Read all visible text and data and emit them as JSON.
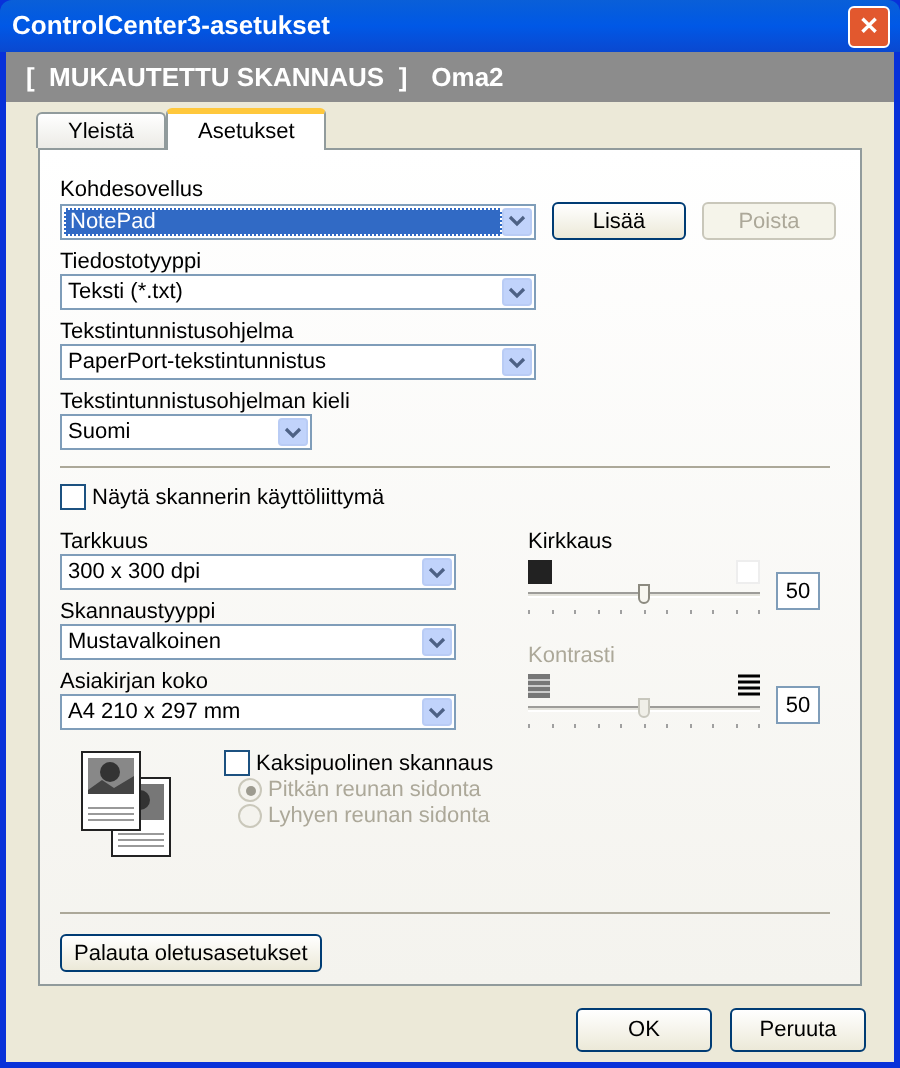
{
  "window": {
    "title": "ControlCenter3-asetukset",
    "close": "✕"
  },
  "header": {
    "section": "[  MUKAUTETTU SKANNAUS  ]",
    "profile": "Oma2"
  },
  "tabs": [
    {
      "label": "Yleistä",
      "selected": false
    },
    {
      "label": "Asetukset",
      "selected": true
    }
  ],
  "top_fields": [
    {
      "label": "Kohdesovellus",
      "value": "NotePad",
      "highlighted": true,
      "kind": "wide"
    },
    {
      "label": "Tiedostotyyppi",
      "value": "Teksti (*.txt)",
      "highlighted": false,
      "kind": "wide"
    },
    {
      "label": "Tekstintunnistusohjelma",
      "value": "PaperPort-tekstintunnistus",
      "highlighted": false,
      "kind": "wide"
    },
    {
      "label": "Tekstintunnistusohjelman kieli",
      "value": "Suomi",
      "highlighted": false,
      "kind": "narrow"
    }
  ],
  "app_buttons": [
    {
      "label": "Lisää",
      "disabled": false
    },
    {
      "label": "Poista",
      "disabled": true
    }
  ],
  "show_scanner_ui": {
    "label": "Näytä skannerin käyttöliittymä",
    "checked": false
  },
  "scan_fields": [
    {
      "label": "Tarkkuus",
      "value": "300 x 300 dpi"
    },
    {
      "label": "Skannaustyyppi",
      "value": "Mustavalkoinen"
    },
    {
      "label": "Asiakirjan koko",
      "value": "A4 210 x 297 mm"
    }
  ],
  "sliders": [
    {
      "kind": "brightness",
      "label": "Kirkkaus",
      "level": 0.5,
      "reading": "50",
      "disabled": false
    },
    {
      "kind": "contrast",
      "label": "Kontrasti",
      "level": 0.5,
      "reading": "50",
      "disabled": true
    }
  ],
  "duplex": {
    "label": "Kaksipuolinen skannaus",
    "checked": false,
    "options": [
      {
        "label": "Pitkän reunan sidonta",
        "selected": true,
        "disabled": true
      },
      {
        "label": "Lyhyen reunan sidonta",
        "selected": false,
        "disabled": true
      }
    ]
  },
  "reset_button": "Palauta oletusasetukset",
  "buttons": [
    "OK",
    "Peruuta"
  ]
}
